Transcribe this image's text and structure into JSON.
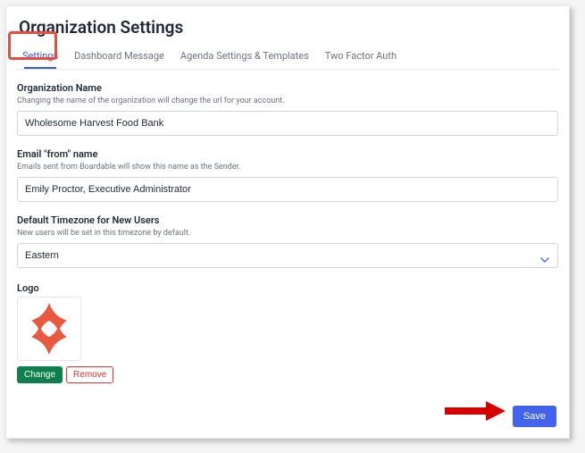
{
  "page_title": "Organization Settings",
  "tabs": {
    "settings": "Settings",
    "dashboard": "Dashboard Message",
    "agenda": "Agenda Settings & Templates",
    "twofa": "Two Factor Auth"
  },
  "org_name": {
    "label": "Organization Name",
    "hint": "Changing the name of the organization will change the url for your account.",
    "value": "Wholesome Harvest Food Bank"
  },
  "email_from": {
    "label": "Email \"from\" name",
    "hint": "Emails sent from Boardable will show this name as the Sender.",
    "value": "Emily Proctor, Executive Administrator"
  },
  "timezone": {
    "label": "Default Timezone for New Users",
    "hint": "New users will be set in this timezone by default.",
    "value": "Eastern"
  },
  "logo": {
    "label": "Logo",
    "change": "Change",
    "remove": "Remove"
  },
  "save_label": "Save",
  "colors": {
    "accent": "#4263eb",
    "danger": "#e03131",
    "success": "#0d804e",
    "highlight": "#e94b3c",
    "logo_fill": "#e9593f"
  }
}
